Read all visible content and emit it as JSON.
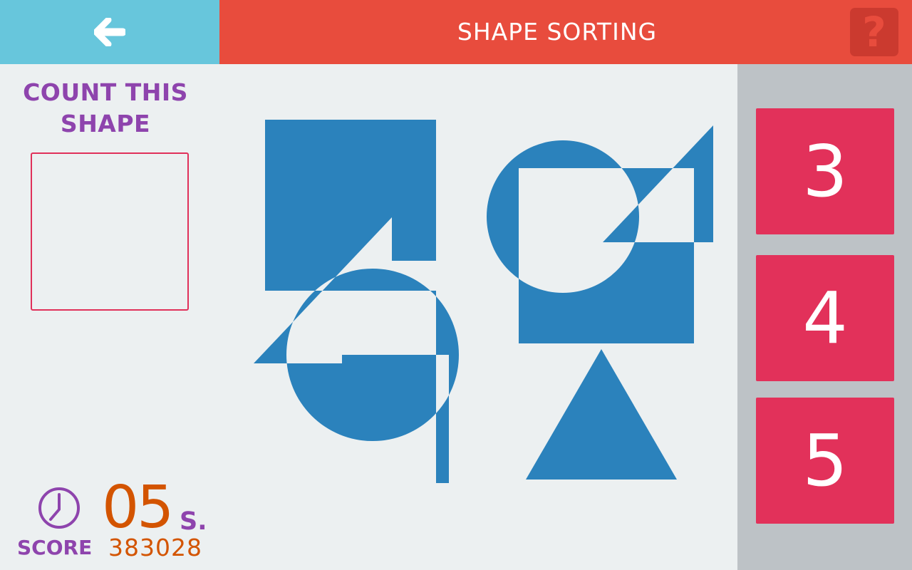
{
  "header": {
    "back_icon": "arrow-left-icon",
    "title": "SHAPE SORTING",
    "help_icon": "question-mark-icon",
    "help_symbol": "?",
    "colors": {
      "back_bg": "#67c6dc",
      "title_bg": "#e84c3d",
      "help_bg": "#cb3a2f"
    }
  },
  "prompt": {
    "line1": "COUNT THIS",
    "line2": "SHAPE",
    "target_shape": "square"
  },
  "timer": {
    "icon": "clock-icon",
    "value": "05",
    "unit": "S."
  },
  "score": {
    "label": "SCORE",
    "value": "383028"
  },
  "puzzle": {
    "shape_color": "#2b82bc",
    "shapes": [
      "square",
      "circle",
      "triangle",
      "square",
      "triangle",
      "square",
      "square",
      "circle",
      "square",
      "triangle"
    ]
  },
  "answers": [
    {
      "label": "3"
    },
    {
      "label": "4"
    },
    {
      "label": "5"
    }
  ],
  "colors": {
    "background": "#ecf0f1",
    "accent_purple": "#8e44ad",
    "accent_orange": "#d35400",
    "answer_button": "#e2315a",
    "target_border": "#e0305a"
  }
}
